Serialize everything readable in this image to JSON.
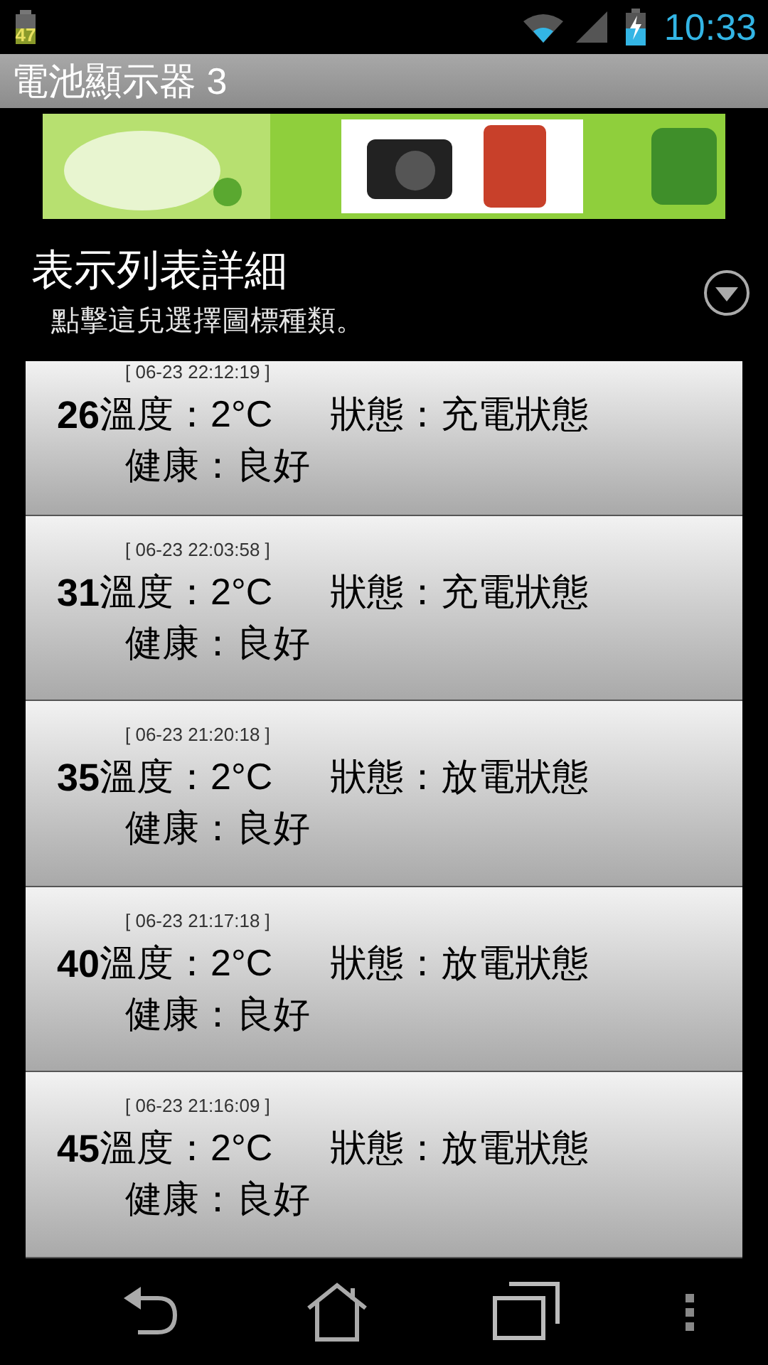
{
  "status_bar": {
    "battery_badge": "47",
    "time": "10:33"
  },
  "action_bar": {
    "title": "電池顯示器 3"
  },
  "header": {
    "title": "表示列表詳細",
    "subtitle": "點擊這兒選擇圖標種類。"
  },
  "rows": [
    {
      "time": "[ 06-23 22:12:19 ]",
      "level": "26",
      "temperature": "溫度：2°C",
      "status": "狀態：充電狀態",
      "health": "健康：良好"
    },
    {
      "time": "[ 06-23 22:03:58 ]",
      "level": "31",
      "temperature": "溫度：2°C",
      "status": "狀態：充電狀態",
      "health": "健康：良好"
    },
    {
      "time": "[ 06-23 21:20:18 ]",
      "level": "35",
      "temperature": "溫度：2°C",
      "status": "狀態：放電狀態",
      "health": "健康：良好"
    },
    {
      "time": "[ 06-23 21:17:18 ]",
      "level": "40",
      "temperature": "溫度：2°C",
      "status": "狀態：放電狀態",
      "health": "健康：良好"
    },
    {
      "time": "[ 06-23 21:16:09 ]",
      "level": "45",
      "temperature": "溫度：2°C",
      "status": "狀態：放電狀態",
      "health": "健康：良好"
    }
  ]
}
